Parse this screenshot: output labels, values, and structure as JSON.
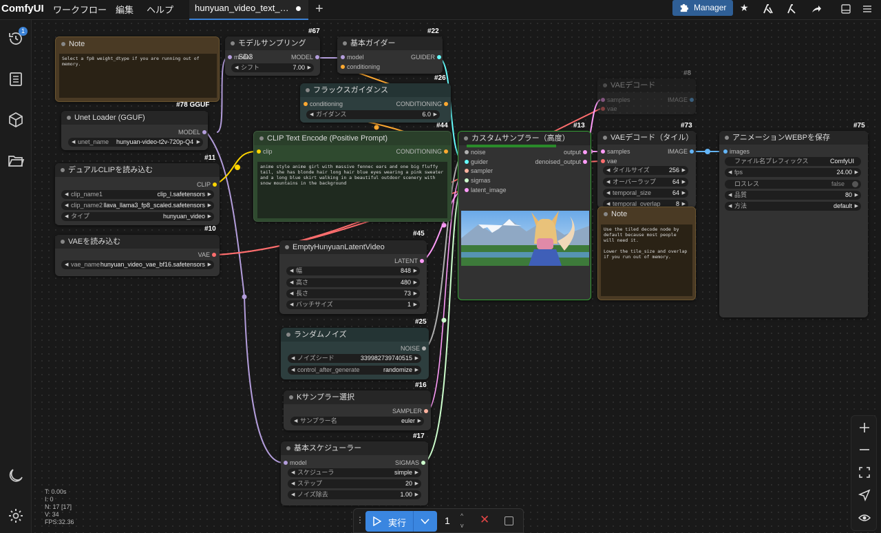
{
  "app": {
    "logo": "ComfyUI",
    "menu": [
      "ワークフロー",
      "編集",
      "ヘルプ"
    ]
  },
  "tab": {
    "label": "hunyuan_video_text_…"
  },
  "manager": {
    "label": "Manager"
  },
  "sidebar": {
    "badge": "1"
  },
  "nodes": {
    "note1": {
      "title": "Note",
      "text": "Select a fp8 weight_dtype if you are running out of  memory."
    },
    "model_sampling": {
      "title": "モデルサンプリングSD3",
      "id": "#67",
      "in_model": "model",
      "out_model": "MODEL",
      "w_label": "シフト",
      "w_value": "7.00"
    },
    "basic_guider": {
      "title": "基本ガイダー",
      "id": "#22",
      "in_model": "model",
      "in_cond": "conditioning",
      "out": "GUIDER"
    },
    "flux_guidance": {
      "title": "フラックスガイダンス",
      "id": "#26",
      "in": "conditioning",
      "out": "CONDITIONING",
      "w_label": "ガイダンス",
      "w_value": "6.0"
    },
    "unet": {
      "title": "Unet Loader (GGUF)",
      "id": "#78 GGUF",
      "out": "MODEL",
      "w_label": "unet_name",
      "w_value": "hunyuan-video-t2v-720p-Q4..."
    },
    "dual_clip": {
      "title": "デュアルCLIPを読み込む",
      "id": "#11",
      "out": "CLIP",
      "w1_label": "clip_name1",
      "w1_value": "clip_l.safetensors",
      "w2_label": "clip_name2",
      "w2_value": "llava_llama3_fp8_scaled.safetensors",
      "w3_label": "タイプ",
      "w3_value": "hunyuan_video"
    },
    "vae_loader": {
      "title": "VAEを読み込む",
      "id": "#10",
      "out": "VAE",
      "w_label": "vae_name",
      "w_value": "hunyuan_video_vae_bf16.safetensors"
    },
    "clip_encode": {
      "title": "CLIP Text Encode (Positive Prompt)",
      "id": "#44",
      "in": "clip",
      "out": "CONDITIONING",
      "text": "anime style anime girl with massive fennec ears and one big fluffy tail, she has blonde hair long hair blue eyes wearing a pink sweater and a long blue skirt walking in a beautiful outdoor scenery with snow mountains in the background"
    },
    "custom_sampler": {
      "title": "カスタムサンプラー（高度）",
      "id": "#13",
      "in1": "noise",
      "in2": "guider",
      "in3": "sampler",
      "in4": "sigmas",
      "in5": "latent_image",
      "out1": "output",
      "out2": "denoised_output"
    },
    "vae_decode_ghost": {
      "title": "VAEデコード",
      "id": "#8",
      "in1": "samples",
      "in2": "vae",
      "out": "IMAGE"
    },
    "vae_decode_tiled": {
      "title": "VAEデコード（タイル）",
      "id": "#73",
      "in1": "samples",
      "in2": "vae",
      "out": "IMAGE",
      "w1_label": "タイルサイズ",
      "w1_value": "256",
      "w2_label": "オーバーラップ",
      "w2_value": "64",
      "w3_label": "temporal_size",
      "w3_value": "64",
      "w4_label": "temporal_overlap",
      "w4_value": "8"
    },
    "note2": {
      "title": "Note",
      "text": "Use the tiled decode node by default because most people will need it.\n\nLower the tile_size and overlap if you run out of memory."
    },
    "save_webp": {
      "title": "アニメーションWEBPを保存",
      "id": "#75",
      "in": "images",
      "w1_label": "ファイル名プレフィックス",
      "w1_value": "ComfyUI",
      "w2_label": "fps",
      "w2_value": "24.00",
      "w3_label": "ロスレス",
      "w3_value": "false",
      "w4_label": "品質",
      "w4_value": "80",
      "w5_label": "方法",
      "w5_value": "default"
    },
    "empty_latent": {
      "title": "EmptyHunyuanLatentVideo",
      "id": "#45",
      "out": "LATENT",
      "w1_label": "幅",
      "w1_value": "848",
      "w2_label": "高さ",
      "w2_value": "480",
      "w3_label": "長さ",
      "w3_value": "73",
      "w4_label": "バッチサイズ",
      "w4_value": "1"
    },
    "random_noise": {
      "title": "ランダムノイズ",
      "id": "#25",
      "out": "NOISE",
      "w1_label": "ノイズシード",
      "w1_value": "339982739740515",
      "w2_label": "control_after_generate",
      "w2_value": "randomize"
    },
    "ksampler_select": {
      "title": "Kサンプラー選択",
      "id": "#16",
      "out": "SAMPLER",
      "w_label": "サンプラー名",
      "w_value": "euler"
    },
    "basic_scheduler": {
      "title": "基本スケジューラー",
      "id": "#17",
      "in": "model",
      "out": "SIGMAS",
      "w1_label": "スケジューラ",
      "w1_value": "simple",
      "w2_label": "ステップ",
      "w2_value": "20",
      "w3_label": "ノイズ除去",
      "w3_value": "1.00"
    }
  },
  "stats": {
    "t": "T: 0.00s",
    "i": "I: 0",
    "n": "N: 17 [17]",
    "v": "V: 34",
    "fps": "FPS:32.36"
  },
  "runbar": {
    "run_label": "実行",
    "count": "1"
  },
  "colors": {
    "accent": "#3a86e0",
    "model_wire": "#b39ddb",
    "clip_wire": "#ffd500",
    "vae_wire": "#ff6e6e",
    "cond_wire": "#ffa931",
    "latent_wire": "#ff9cf9",
    "image_wire": "#64b5f6",
    "noise_wire": "#b0b0b0",
    "sigmas_wire": "#cdffcd",
    "guider_wire": "#66ffff"
  }
}
